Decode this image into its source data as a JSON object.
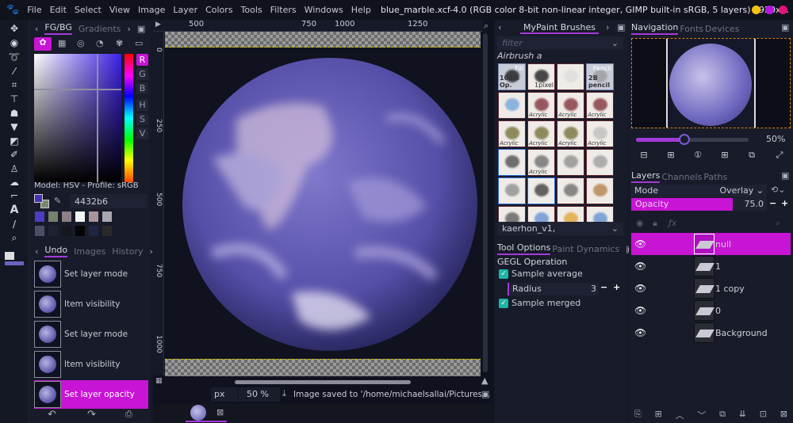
{
  "menubar": {
    "items": [
      "File",
      "Edit",
      "Select",
      "View",
      "Image",
      "Layer",
      "Colors",
      "Tools",
      "Filters",
      "Windows",
      "Help"
    ],
    "title": "blue_marble.xcf-4.0 (RGB color 8-bit non-linear integer, GIMP built-in sRGB, 5 layers) 1920x...",
    "window_dots": [
      "#f4c20d",
      "#b516e0",
      "#e0147a"
    ]
  },
  "colors": {
    "accent": "#c814d4",
    "fg": "#4432b6",
    "bg": "#7a8a72"
  },
  "left_dock": {
    "tabs": [
      "FG/BG",
      "Gradients"
    ],
    "active_tab": "FG/BG",
    "channels": [
      "R",
      "G",
      "B",
      "H",
      "S",
      "V"
    ],
    "model_text": "Model: HSV - Profile: sRGB",
    "hex_value": "4432b6",
    "swatches": [
      "#4c3ec0",
      "#75826e",
      "#8f7f85",
      "#f4f4f4",
      "#a99498",
      "#a9a6b0",
      "#4b4f66",
      "#1f2232",
      "#15171f",
      "#050507",
      "#1e2444",
      "#2a2a2a"
    ]
  },
  "undo": {
    "tabs": [
      "Undo",
      "Images",
      "History"
    ],
    "active_tab": "Undo",
    "items": [
      "Set layer mode",
      "Item visibility",
      "Set layer mode",
      "Item visibility",
      "Set layer opacity"
    ],
    "selected_index": 4
  },
  "canvas": {
    "hruler": [
      "500",
      "750",
      "1000",
      "1250"
    ],
    "vruler": [
      "0",
      "250",
      "500",
      "750",
      "1000"
    ]
  },
  "statusbar": {
    "unit": "px",
    "zoom": "50 %",
    "message": "Image saved to '/home/michaelsallai/Pictures..."
  },
  "brushes": {
    "tab": "MyPaint Brushes",
    "filter_placeholder": "filter",
    "current_name": "Airbrush a",
    "selected_set": "kaerhon_v1,",
    "labels": {
      "fill": "Fill",
      "op": "100% Op.",
      "pixel": "1pixel",
      "pencil": "Pencil",
      "pencil2b": "2B pencil",
      "acrylic": "Acrylic"
    }
  },
  "tool_options": {
    "tabs": [
      "Tool Options",
      "Paint Dynamics"
    ],
    "active_tab": "Tool Options",
    "heading": "GEGL Operation",
    "sample_average": "Sample average",
    "radius_label": "Radius",
    "radius_value": "3",
    "sample_merged": "Sample merged"
  },
  "navigation": {
    "tabs": [
      "Navigation",
      "Fonts",
      "Devices"
    ],
    "active_tab": "Navigation",
    "zoom": "50%",
    "zoom_fraction": 0.43
  },
  "layers": {
    "tabs": [
      "Layers",
      "Channels",
      "Paths"
    ],
    "active_tab": "Layers",
    "mode_label": "Mode",
    "mode_value": "Overlay",
    "opacity_label": "Opacity",
    "opacity_value": "75.0",
    "opacity_fraction": 0.75,
    "items": [
      {
        "name": "null",
        "selected": true
      },
      {
        "name": "1"
      },
      {
        "name": "1 copy"
      },
      {
        "name": "0"
      },
      {
        "name": "Background"
      }
    ]
  }
}
